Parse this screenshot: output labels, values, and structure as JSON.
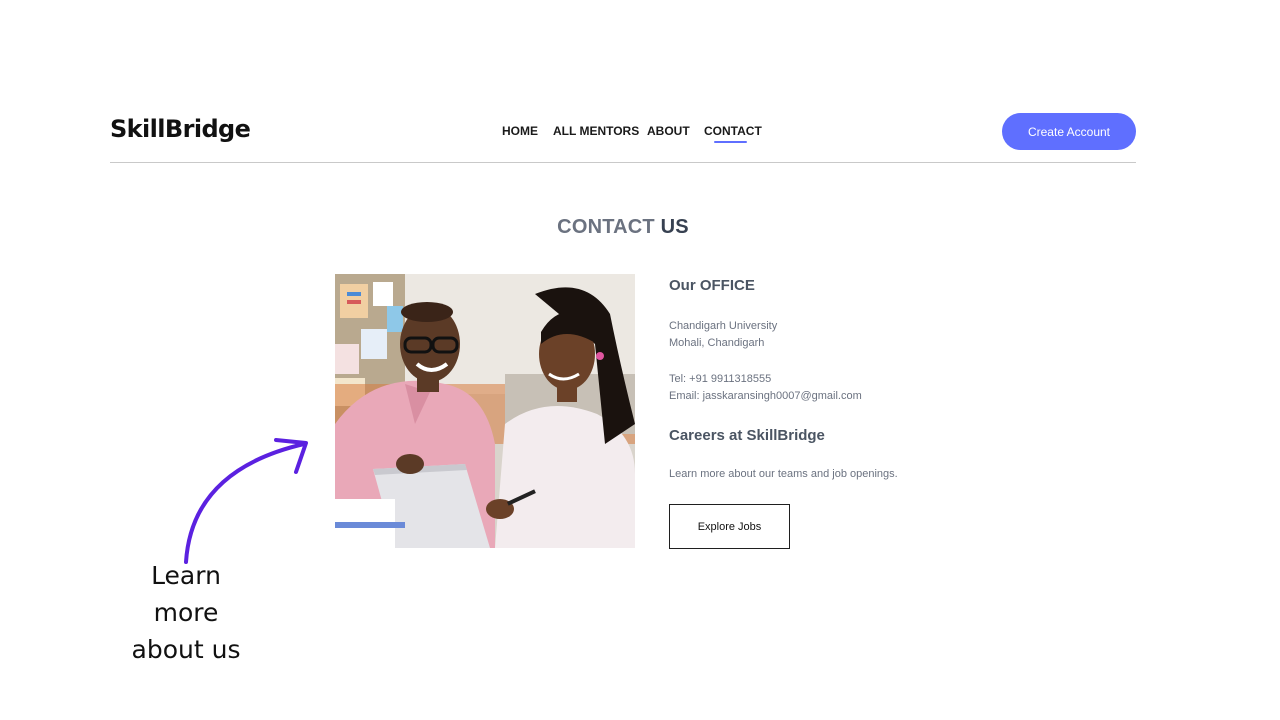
{
  "header": {
    "logo": "SkillBridge",
    "nav": [
      "HOME",
      "ALL MENTORS",
      "ABOUT",
      "CONTACT"
    ],
    "active_nav": "CONTACT",
    "cta_label": "Create Account"
  },
  "page": {
    "title_prefix": "CONTACT",
    "title_emphasis": "US"
  },
  "office": {
    "heading": "Our OFFICE",
    "address_line1": "Chandigarh University",
    "address_line2": "Mohali, Chandigarh",
    "tel": "Tel: +91 9911318555",
    "email": "Email: jasskaransingh0007@gmail.com"
  },
  "careers": {
    "heading": "Careers at SkillBridge",
    "text": "Learn more about our teams and job openings.",
    "button_label": "Explore Jobs"
  },
  "annotation": {
    "line1": "Learn",
    "line2": "more",
    "line3": "about us"
  },
  "colors": {
    "accent": "#5f6fff",
    "arrow": "#5b21e0"
  }
}
